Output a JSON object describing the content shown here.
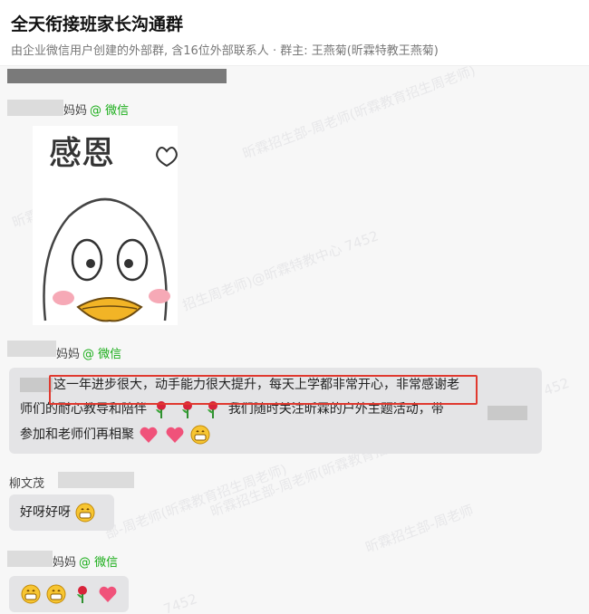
{
  "header": {
    "title": "全天衔接班家长沟通群",
    "subtitle": "由企业微信用户创建的外部群, 含16位外部联系人 · 群主: 王燕菊(昕霖特教王燕菊)"
  },
  "watermark": [
    "昕霖招生部-周老师(昕霖教育招生周老师)",
    "昕霖特教中心 7452",
    "招生周老师)@昕霖特教中心 7452",
    "昕霖招生部-周老师(昕霖教育招生周老师)@昕霖特教中心 7452",
    "部-周老师(昕霖教育招生周老师)",
    "昕霖招生部-周老师",
    "7452"
  ],
  "messages": [
    {
      "sender": "妈妈",
      "channel": "@ 微信",
      "sticker_text": "感恩"
    },
    {
      "sender": "妈妈",
      "channel": "@ 微信",
      "lines": [
        "这一年进步很大，动手能力很大提升，每天上学都非常开心，非常感谢老",
        "师们的耐心教导和陪伴",
        "我们随时关注昕霖的户外主题活动，带",
        "参加和老师们再相聚"
      ]
    },
    {
      "sender": "柳文茂",
      "text": "好呀好呀"
    },
    {
      "sender": "妈妈",
      "channel": "@ 微信"
    }
  ],
  "colors": {
    "accent": "#1aad19",
    "highlight": "#e0392f",
    "bubble": "#e4e4e6"
  }
}
